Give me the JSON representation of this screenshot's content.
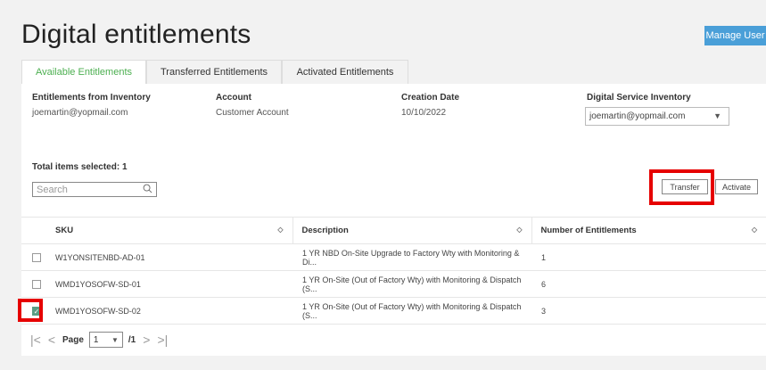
{
  "header": {
    "title": "Digital entitlements",
    "manage_label": "Manage User"
  },
  "tabs": [
    {
      "label": "Available Entitlements"
    },
    {
      "label": "Transferred Entitlements"
    },
    {
      "label": "Activated Entitlements"
    }
  ],
  "info": {
    "inventory_label": "Entitlements from Inventory",
    "inventory_value": "joemartin@yopmail.com",
    "account_label": "Account",
    "account_value": "Customer Account",
    "date_label": "Creation Date",
    "date_value": "10/10/2022",
    "service_label": "Digital Service Inventory",
    "service_value": "joemartin@yopmail.com"
  },
  "selection": {
    "total_text": "Total items selected: 1"
  },
  "search": {
    "placeholder": "Search"
  },
  "actions": {
    "transfer_label": "Transfer",
    "activate_label": "Activate"
  },
  "table": {
    "headers": {
      "sku": "SKU",
      "description": "Description",
      "count": "Number of Entitlements"
    },
    "rows": [
      {
        "sku": "W1YONSITENBD-AD-01",
        "description": "1 YR NBD On-Site Upgrade to Factory Wty with Monitoring & Di...",
        "count": "1",
        "checked": false
      },
      {
        "sku": "WMD1YOSOFW-SD-01",
        "description": "1 YR On-Site (Out of Factory Wty) with Monitoring & Dispatch (S...",
        "count": "6",
        "checked": false
      },
      {
        "sku": "WMD1YOSOFW-SD-02",
        "description": "1 YR On-Site (Out of Factory Wty) with Monitoring & Dispatch (S...",
        "count": "3",
        "checked": true
      }
    ]
  },
  "pager": {
    "page_label": "Page",
    "current": "1",
    "total": "/1"
  },
  "colors": {
    "accent": "#4caf50",
    "button": "#4a9fd8",
    "highlight": "#e60000",
    "checkbox": "#5a9e84"
  }
}
